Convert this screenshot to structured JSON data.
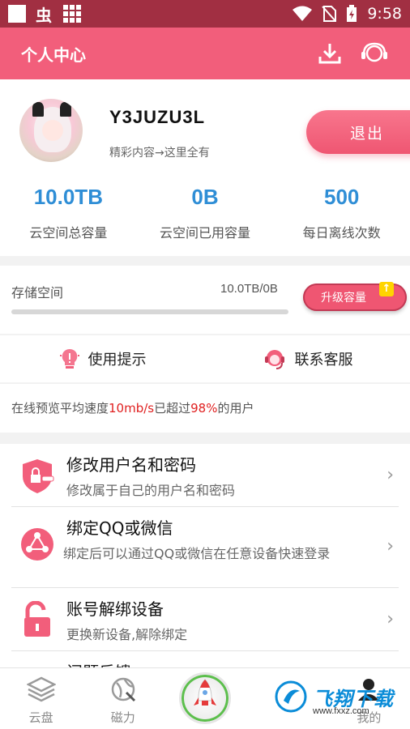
{
  "status_bar": {
    "time": "9:58"
  },
  "header": {
    "title": "个人中心"
  },
  "profile": {
    "username": "Y3JUZU3L",
    "slogan": "精彩内容→这里全有",
    "logout_label": "退出"
  },
  "stats": [
    {
      "value": "10.0TB",
      "label": "云空间总容量"
    },
    {
      "value": "0B",
      "label": "云空间已用容量"
    },
    {
      "value": "500",
      "label": "每日离线次数"
    }
  ],
  "storage": {
    "label": "存储空间",
    "amount": "10.0TB/0B",
    "used_fraction": 0,
    "upgrade_label": "升级容量"
  },
  "quick_links": [
    {
      "label": "使用提示",
      "icon": "lightbulb-icon"
    },
    {
      "label": "联系客服",
      "icon": "customer-service-icon"
    }
  ],
  "speed_note": {
    "prefix": "在线预览平均速度",
    "speed": "10mb/s",
    "middle": "已超过",
    "percent": "98%",
    "suffix": "的用户"
  },
  "menu": [
    {
      "title": "修改用户名和密码",
      "subtitle": "修改属于自己的用户名和密码",
      "icon": "shield-lock-icon"
    },
    {
      "title": "绑定QQ或微信",
      "subtitle": "绑定后可以通过QQ或微信在任意设备快速登录",
      "icon": "link-nodes-icon"
    },
    {
      "title": "账号解绑设备",
      "subtitle": "更换新设备,解除绑定",
      "icon": "unlock-icon"
    },
    {
      "title": "问题反馈",
      "subtitle": "",
      "icon": "feedback-icon"
    }
  ],
  "tabbar": [
    {
      "label": "云盘",
      "icon": "layers-icon"
    },
    {
      "label": "磁力",
      "icon": "magnet-globe-icon"
    },
    {
      "label": "",
      "icon": "rocket-icon"
    },
    {
      "label": "",
      "icon": ""
    },
    {
      "label": "我的",
      "icon": "user-icon"
    }
  ],
  "watermark": {
    "brand": "飞翔下载",
    "url": "www.fxxz.com"
  },
  "colors": {
    "accent": "#f25e7b",
    "status_bar": "#a12f42",
    "stat_value": "#2f8ed6",
    "highlight": "#e02020"
  }
}
